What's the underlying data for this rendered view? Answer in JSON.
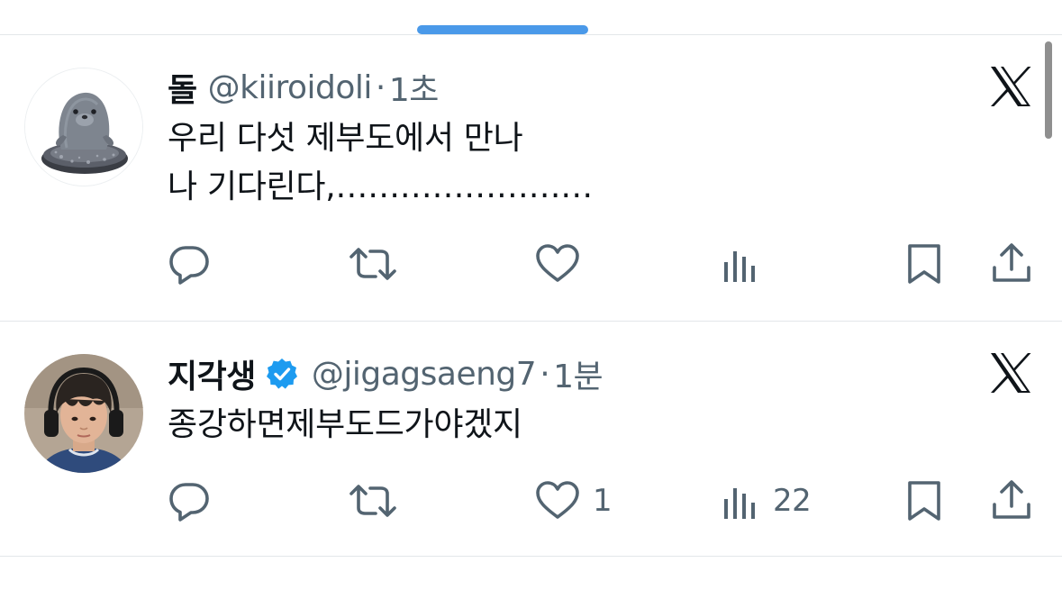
{
  "colors": {
    "accent": "#4a99e9",
    "verified": "#1d9bf0",
    "secondary_text": "#536471",
    "primary_text": "#0f1419",
    "divider": "#e3e7ea"
  },
  "tweets": [
    {
      "name": "돌",
      "handle": "@kiiroidoli",
      "separator": "·",
      "time": "1초",
      "verified": false,
      "lines": [
        "우리 다섯 제부도에서 만나",
        "나 기다린다,……………………"
      ],
      "menu_icon": "x-logo-icon",
      "avatar_icon": "stone-seal-figure",
      "actions": {
        "reply_count": "",
        "retweet_count": "",
        "like_count": "",
        "view_count": ""
      }
    },
    {
      "name": "지각생",
      "handle": "@jigagsaeng7",
      "separator": "·",
      "time": "1분",
      "verified": true,
      "lines": [
        "종강하면제부도드가야겠지"
      ],
      "menu_icon": "x-logo-icon",
      "avatar_icon": "person-with-headphones",
      "actions": {
        "reply_count": "",
        "retweet_count": "",
        "like_count": "1",
        "view_count": "22"
      }
    }
  ]
}
